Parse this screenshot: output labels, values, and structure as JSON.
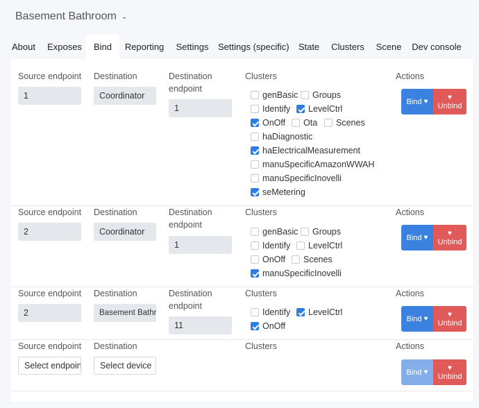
{
  "header": {
    "title": "Basement Bathroom"
  },
  "tabs": [
    "About",
    "Exposes",
    "Bind",
    "Reporting",
    "Settings",
    "Settings (specific)",
    "State",
    "Clusters",
    "Scene",
    "Dev console"
  ],
  "labels": {
    "source_endpoint": "Source endpoint",
    "destination": "Destination",
    "destination_endpoint_line1": "Destination",
    "destination_endpoint_line2": "endpoint",
    "clusters": "Clusters",
    "actions": "Actions",
    "bind": "Bind",
    "unbind": "Unbind"
  },
  "rows": [
    {
      "source": "1",
      "destination": "Coordinator",
      "dest_endpoint": "1",
      "clusters": [
        {
          "name": "genBasic",
          "checked": false
        },
        {
          "name": "Groups",
          "checked": false
        },
        {
          "name": "Identify",
          "checked": false
        },
        {
          "name": "LevelCtrl",
          "checked": true
        },
        {
          "name": "OnOff",
          "checked": true
        },
        {
          "name": "Ota",
          "checked": false
        },
        {
          "name": "Scenes",
          "checked": false
        },
        {
          "name": "haDiagnostic",
          "checked": false
        },
        {
          "name": "haElectricalMeasurement",
          "checked": true
        },
        {
          "name": "manuSpecificAmazonWWAH",
          "checked": false
        },
        {
          "name": "manuSpecificInovelli",
          "checked": false
        },
        {
          "name": "seMetering",
          "checked": true
        }
      ]
    },
    {
      "source": "2",
      "destination": "Coordinator",
      "dest_endpoint": "1",
      "clusters": [
        {
          "name": "genBasic",
          "checked": false
        },
        {
          "name": "Groups",
          "checked": false
        },
        {
          "name": "Identify",
          "checked": false
        },
        {
          "name": "LevelCtrl",
          "checked": false
        },
        {
          "name": "OnOff",
          "checked": false
        },
        {
          "name": "Scenes",
          "checked": false
        },
        {
          "name": "manuSpecificInovelli",
          "checked": true
        }
      ]
    },
    {
      "source": "2",
      "destination": "Basement Bathroom",
      "dest_endpoint": "11",
      "clusters": [
        {
          "name": "Identify",
          "checked": false
        },
        {
          "name": "LevelCtrl",
          "checked": true
        },
        {
          "name": "OnOff",
          "checked": true
        }
      ]
    },
    {
      "source_placeholder": "Select endpoint",
      "destination_placeholder": "Select device"
    }
  ],
  "colors": {
    "accent": "#3b82e0",
    "danger": "#e05a5a",
    "checkbox": "#2f7de1"
  }
}
